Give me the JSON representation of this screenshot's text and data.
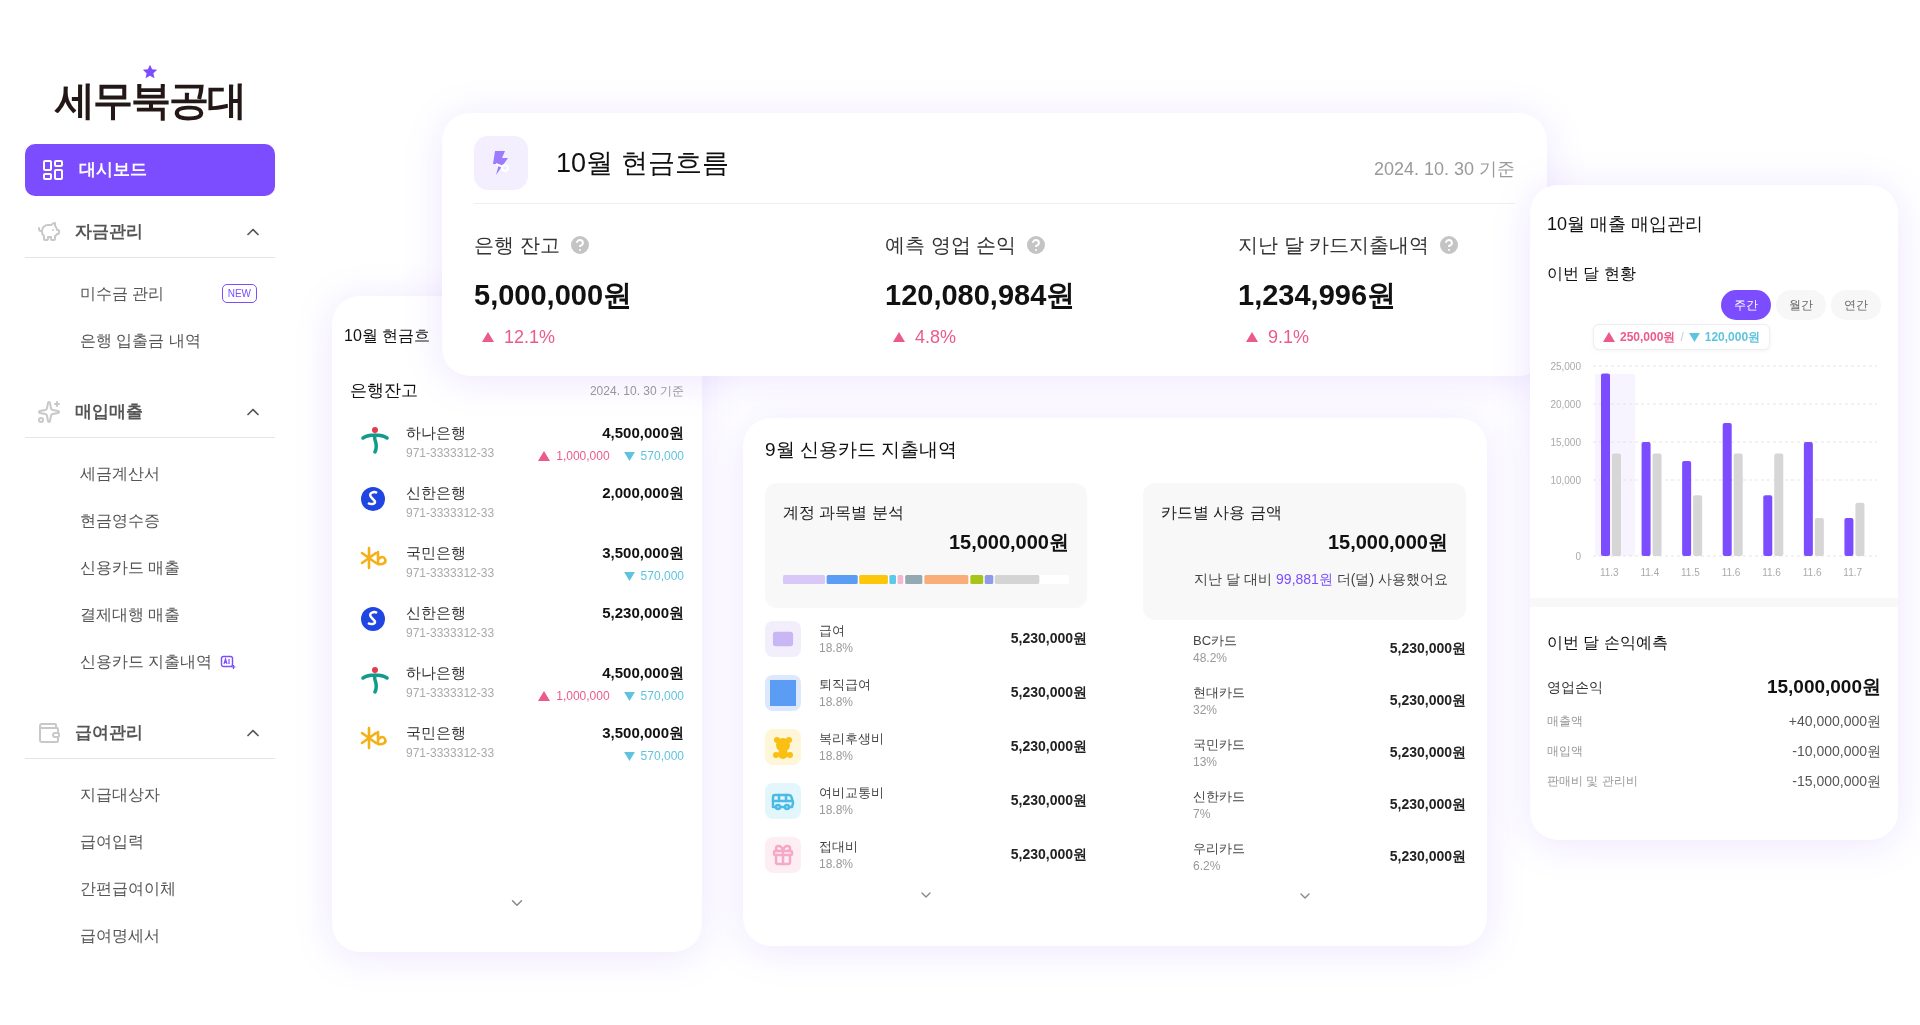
{
  "logo": {
    "text": "세무북공대"
  },
  "sidebar": {
    "items": [
      {
        "kind": "link",
        "label": "대시보드",
        "selected": true
      },
      {
        "kind": "section",
        "label": "자금관리",
        "expanded": true,
        "children": [
          {
            "label": "미수금 관리",
            "badge": "NEW",
            "selected": false
          },
          {
            "label": "은행 입출금 내역",
            "selected": false
          }
        ]
      },
      {
        "kind": "section",
        "label": "매입매출",
        "expanded": true,
        "children": [
          {
            "label": "세금계산서",
            "selected": false
          },
          {
            "label": "현금영수증",
            "selected": false
          },
          {
            "label": "신용카드 매출",
            "selected": false
          },
          {
            "label": "결제대행 매출",
            "selected": false
          },
          {
            "label": "신용카드 지출내역",
            "ai": true,
            "selected": false
          }
        ]
      },
      {
        "kind": "section",
        "label": "급여관리",
        "expanded": true,
        "children": [
          {
            "label": "지급대상자",
            "selected": false
          },
          {
            "label": "급여입력",
            "selected": false
          },
          {
            "label": "간편급여이체",
            "selected": false
          },
          {
            "label": "급여명세서",
            "selected": false
          }
        ]
      }
    ]
  },
  "cashflow_card": {
    "title": "10월 현금흐름",
    "date": "2024. 10. 30 기준",
    "metrics": [
      {
        "label": "은행 잔고",
        "value": "5,000,000원",
        "change": "12.1%",
        "rising": true
      },
      {
        "label": "예측 영업 손익",
        "value": "120,080,984원",
        "change": "4.8%",
        "rising": true
      },
      {
        "label": "지난 달 카드지출내역",
        "value": "1,234,996원",
        "change": "9.1%",
        "rising": true
      }
    ]
  },
  "bank_card": {
    "title": "10월 현금흐",
    "subtitle": "은행잔고",
    "date": "2024. 10. 30 기준",
    "rows": [
      {
        "kind": "hana",
        "name": "하나은행",
        "account": "971-3333312-33",
        "amount": "4,500,000원",
        "in": "1,000,000",
        "out": "570,000"
      },
      {
        "kind": "shinhan",
        "name": "신한은행",
        "account": "971-3333312-33",
        "amount": "2,000,000원"
      },
      {
        "kind": "kb",
        "name": "국민은행",
        "account": "971-3333312-33",
        "amount": "3,500,000원",
        "out": "570,000"
      },
      {
        "kind": "shinhan",
        "name": "신한은행",
        "account": "971-3333312-33",
        "amount": "5,230,000원"
      },
      {
        "kind": "hana",
        "name": "하나은행",
        "account": "971-3333312-33",
        "amount": "4,500,000원",
        "in": "1,000,000",
        "out": "570,000"
      },
      {
        "kind": "kb",
        "name": "국민은행",
        "account": "971-3333312-33",
        "amount": "3,500,000원",
        "out": "570,000"
      }
    ]
  },
  "card_spending": {
    "title": "9월 신용카드 지출내역",
    "by_account": {
      "title": "계정 과목별 분석",
      "total": "15,000,000원",
      "items": [
        {
          "kind": "card",
          "name": "급여",
          "share": "18.8%",
          "amount": "5,230,000원"
        },
        {
          "kind": "square",
          "name": "퇴직급여",
          "share": "18.8%",
          "amount": "5,230,000원"
        },
        {
          "kind": "bear",
          "name": "복리후생비",
          "share": "18.8%",
          "amount": "5,230,000원"
        },
        {
          "kind": "bus",
          "name": "여비교통비",
          "share": "18.8%",
          "amount": "5,230,000원"
        },
        {
          "kind": "gift",
          "name": "접대비",
          "share": "18.8%",
          "amount": "5,230,000원"
        }
      ]
    },
    "by_card": {
      "title": "카드별 사용 금액",
      "total": "15,000,000원",
      "note_before": "지난 달 대비",
      "note_amount": "99,881원",
      "note_after": "더(덜) 사용했어요",
      "items": [
        {
          "name": "BC카드",
          "share": "48.2%",
          "amount": "5,230,000원"
        },
        {
          "name": "현대카드",
          "share": "32%",
          "amount": "5,230,000원"
        },
        {
          "name": "국민카드",
          "share": "13%",
          "amount": "5,230,000원"
        },
        {
          "name": "신한카드",
          "share": "7%",
          "amount": "5,230,000원"
        },
        {
          "name": "우리카드",
          "share": "6.2%",
          "amount": "5,230,000원"
        }
      ]
    }
  },
  "sales_card": {
    "title": "10월 매출 매입관리",
    "subtitle": "이번 달 현황",
    "periods": [
      {
        "label": "주간",
        "selected": true
      },
      {
        "label": "월간",
        "selected": false
      },
      {
        "label": "연간",
        "selected": false
      }
    ],
    "tooltip": {
      "up": "250,000원",
      "separator": "/",
      "down": "120,000원"
    },
    "chart_data": {
      "type": "bar",
      "categories": [
        "11.3",
        "11.4",
        "11.5",
        "11.6",
        "11.6",
        "11.6",
        "11.7"
      ],
      "series": [
        {
          "color": "#7c4dff",
          "values": [
            24000,
            15000,
            12500,
            17500,
            8000,
            15000,
            5000
          ]
        },
        {
          "color": "#d6d6d6",
          "values": [
            13500,
            13500,
            8000,
            13500,
            13500,
            5000,
            7000
          ]
        }
      ],
      "ylim": [
        0,
        25000
      ],
      "grid": true,
      "yticks": [
        {
          "value": 0,
          "label": "0"
        },
        {
          "value": 10000,
          "label": "10,000"
        },
        {
          "value": 15000,
          "label": "15,000"
        },
        {
          "value": 20000,
          "label": "20,000"
        },
        {
          "value": 25000,
          "label": "25,000"
        }
      ]
    },
    "bar_groups": [
      {
        "selected": true
      },
      {
        "selected": false
      },
      {
        "selected": false
      },
      {
        "selected": false
      },
      {
        "selected": false
      },
      {
        "selected": false
      },
      {
        "selected": false
      }
    ],
    "forecast_title": "이번 달 손익예측",
    "forecast": [
      {
        "kind": "total",
        "label": "영업손익",
        "value": "15,000,000원"
      },
      {
        "kind": "item",
        "label": "매출액",
        "value": "+40,000,000원"
      },
      {
        "kind": "item",
        "label": "매입액",
        "value": "-10,000,000원"
      },
      {
        "kind": "item",
        "label": "판매비 및 관리비",
        "value": "-15,000,000원"
      }
    ]
  }
}
